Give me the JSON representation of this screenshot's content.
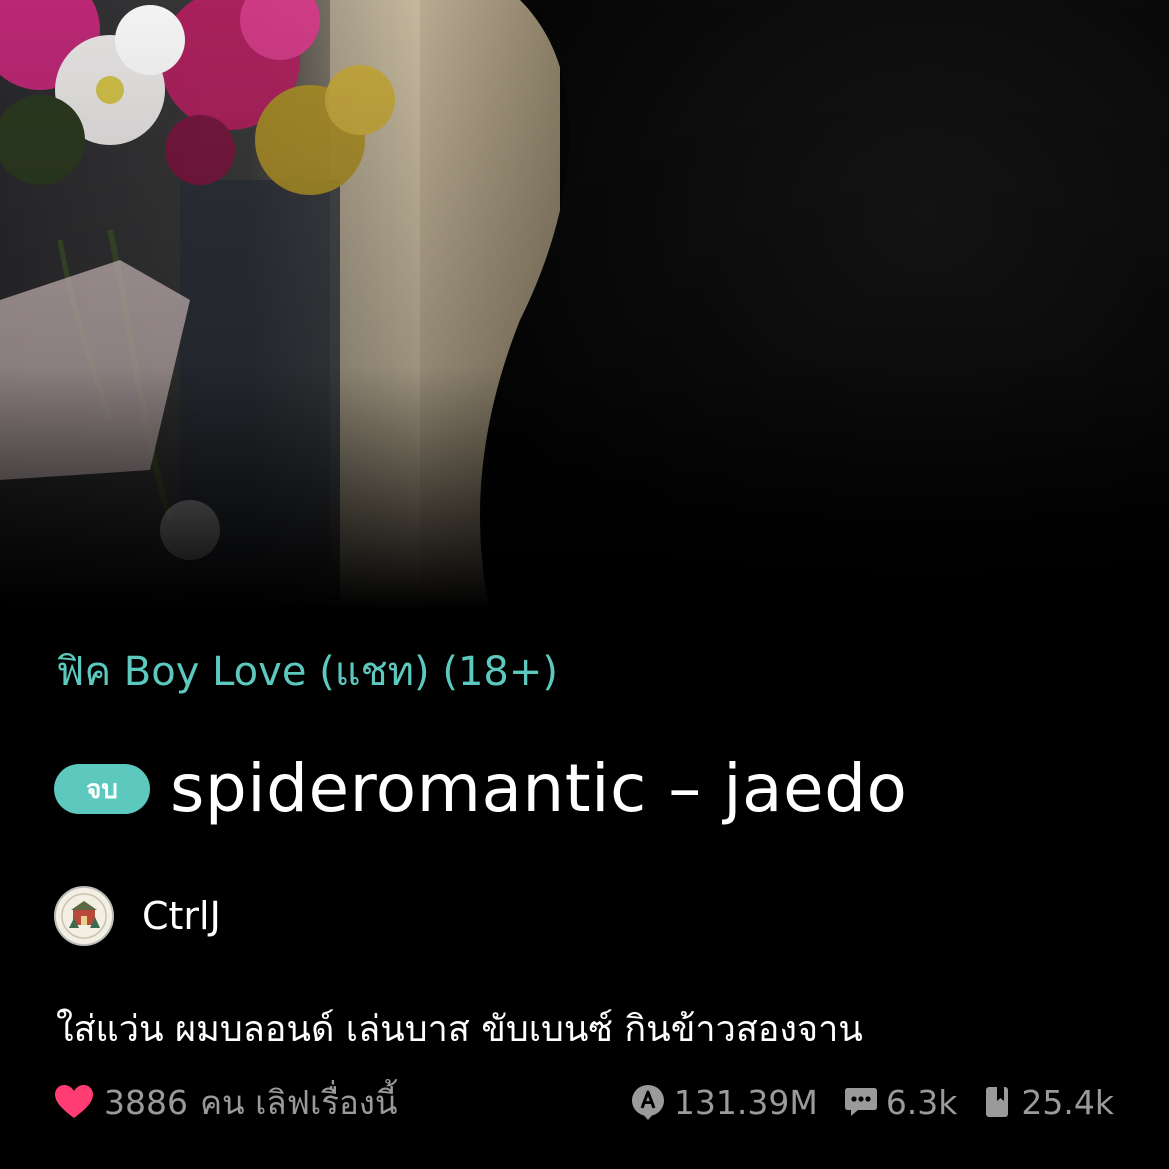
{
  "category": "ฟิค Boy Love (แชท) (18+)",
  "status_badge": "จบ",
  "title": "spideromantic – jaedo",
  "author": "CtrlJ",
  "synopsis": "ใส่แว่น ผมบลอนด์ เล่นบาส ขับเบนซ์ กินข้าวสองจาน",
  "love": {
    "count": "3886",
    "text": "คน เลิฟเรื่องนี้"
  },
  "stats": {
    "views": "131.39M",
    "comments": "6.3k",
    "bookmarks": "25.4k"
  },
  "colors": {
    "accent": "#5cc8be",
    "heart": "#ff3d73",
    "muted": "#9a9a9a",
    "background": "#000000"
  },
  "icons": {
    "love": "heart-icon",
    "views": "view-count-icon",
    "comments": "comment-icon",
    "bookmarks": "bookmark-icon"
  }
}
